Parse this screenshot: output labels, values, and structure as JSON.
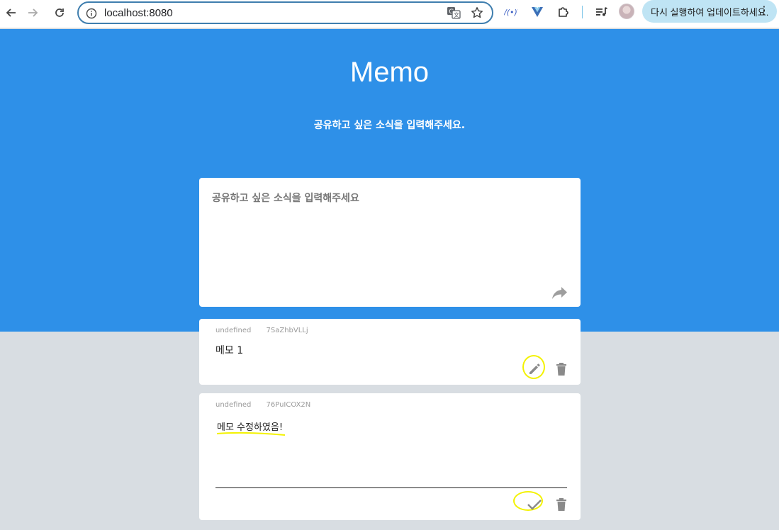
{
  "browser": {
    "url": "localhost:8080",
    "update_button": "다시 실행하여 업데이트하세요.",
    "more_menu": "⋮"
  },
  "header": {
    "title": "Memo",
    "subtitle": "공유하고 싶은 소식을 입력해주세요."
  },
  "compose": {
    "placeholder": "공유하고 싶은 소식을 입력해주세요",
    "value": ""
  },
  "memos": [
    {
      "author": "undefined",
      "id": "7SaZhbVLLj",
      "content": "메모 1",
      "editing": false
    },
    {
      "author": "undefined",
      "id": "76PuICOX2N",
      "content": "메모 수정하였음!",
      "editing": true
    }
  ],
  "colors": {
    "hero": "#2e90e8",
    "background": "#d8dde2",
    "highlight": "#f3f200",
    "icon": "#9e9e9e"
  },
  "icons": {
    "share": "share-arrow-icon",
    "edit": "pencil-icon",
    "save": "check-icon",
    "delete": "trash-icon"
  }
}
